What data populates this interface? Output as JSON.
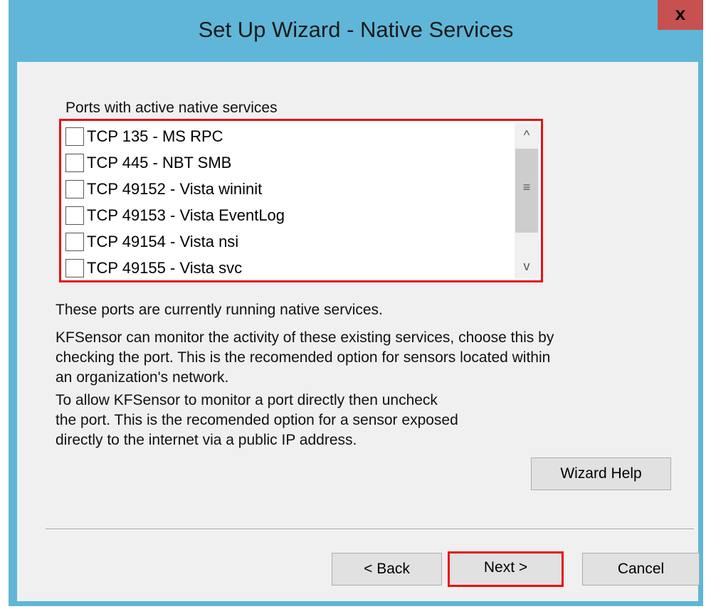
{
  "window": {
    "title": "Set Up Wizard - Native Services",
    "close_label": "x"
  },
  "ports_list": {
    "label": "Ports with active native services",
    "items": [
      {
        "label": "TCP 135 - MS RPC",
        "checked": false
      },
      {
        "label": "TCP 445 - NBT SMB",
        "checked": false
      },
      {
        "label": "TCP 49152 - Vista wininit",
        "checked": false
      },
      {
        "label": "TCP 49153 - Vista EventLog",
        "checked": false
      },
      {
        "label": "TCP 49154 - Vista nsi",
        "checked": false
      },
      {
        "label": "TCP 49155 - Vista svc",
        "checked": false
      }
    ],
    "scroll_up": "^",
    "scroll_down": "v",
    "scroll_grip": "≡"
  },
  "description": {
    "line1": "These ports are currently running native services.",
    "para2_l1": "KFSensor can monitor the activity of these existing services, choose this by",
    "para2_l2": "checking the port. This is the recomended option for sensors located within",
    "para2_l3": "an organization's network.",
    "para3_l1": "To allow KFSensor to monitor a port directly then uncheck",
    "para3_l2": "the port. This is the recomended option for a sensor exposed",
    "para3_l3": "directly to the internet via a public IP address."
  },
  "buttons": {
    "wizard_help": "Wizard Help",
    "back": "< Back",
    "next": "Next >",
    "cancel": "Cancel"
  },
  "colors": {
    "title_bar": "#5fb6d8",
    "close_button": "#c75050",
    "highlight": "#e81010",
    "client_bg": "#f0f0f0"
  }
}
